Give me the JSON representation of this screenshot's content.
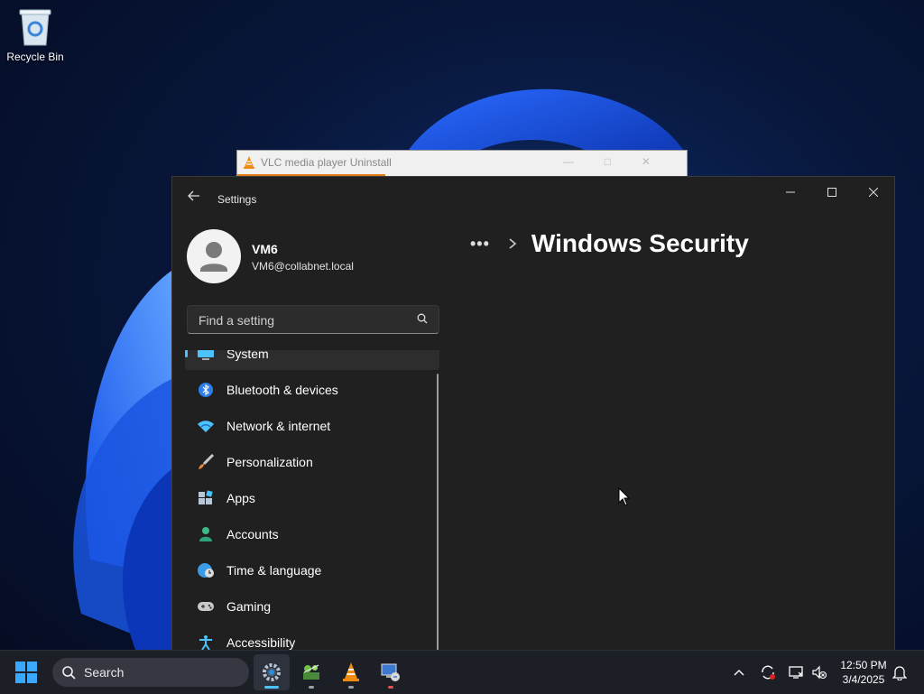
{
  "desktop": {
    "recycle_bin_label": "Recycle Bin"
  },
  "vlc_window": {
    "title": "VLC media player Uninstall",
    "progress_fraction": 0.33
  },
  "settings": {
    "app_title": "Settings",
    "user": {
      "name": "VM6",
      "email": "VM6@collabnet.local"
    },
    "search": {
      "placeholder": "Find a setting"
    },
    "breadcrumb": {
      "more": "•••",
      "separator": ">",
      "page_title": "Windows Security"
    },
    "nav": [
      {
        "label": "System",
        "icon": "monitor-icon",
        "selected": true
      },
      {
        "label": "Bluetooth & devices",
        "icon": "bluetooth-icon"
      },
      {
        "label": "Network & internet",
        "icon": "wifi-icon"
      },
      {
        "label": "Personalization",
        "icon": "brush-icon"
      },
      {
        "label": "Apps",
        "icon": "apps-icon"
      },
      {
        "label": "Accounts",
        "icon": "person-icon"
      },
      {
        "label": "Time & language",
        "icon": "globe-clock-icon"
      },
      {
        "label": "Gaming",
        "icon": "gamepad-icon"
      },
      {
        "label": "Accessibility",
        "icon": "accessibility-icon"
      }
    ],
    "colors": {
      "accent": "#4cc2ff",
      "background": "#202020"
    }
  },
  "taskbar": {
    "search_label": "Search",
    "apps": [
      "settings-gear",
      "network-tool",
      "vlc",
      "remote-desktop"
    ],
    "clock": {
      "time": "12:50 PM",
      "date": "3/4/2025"
    }
  }
}
